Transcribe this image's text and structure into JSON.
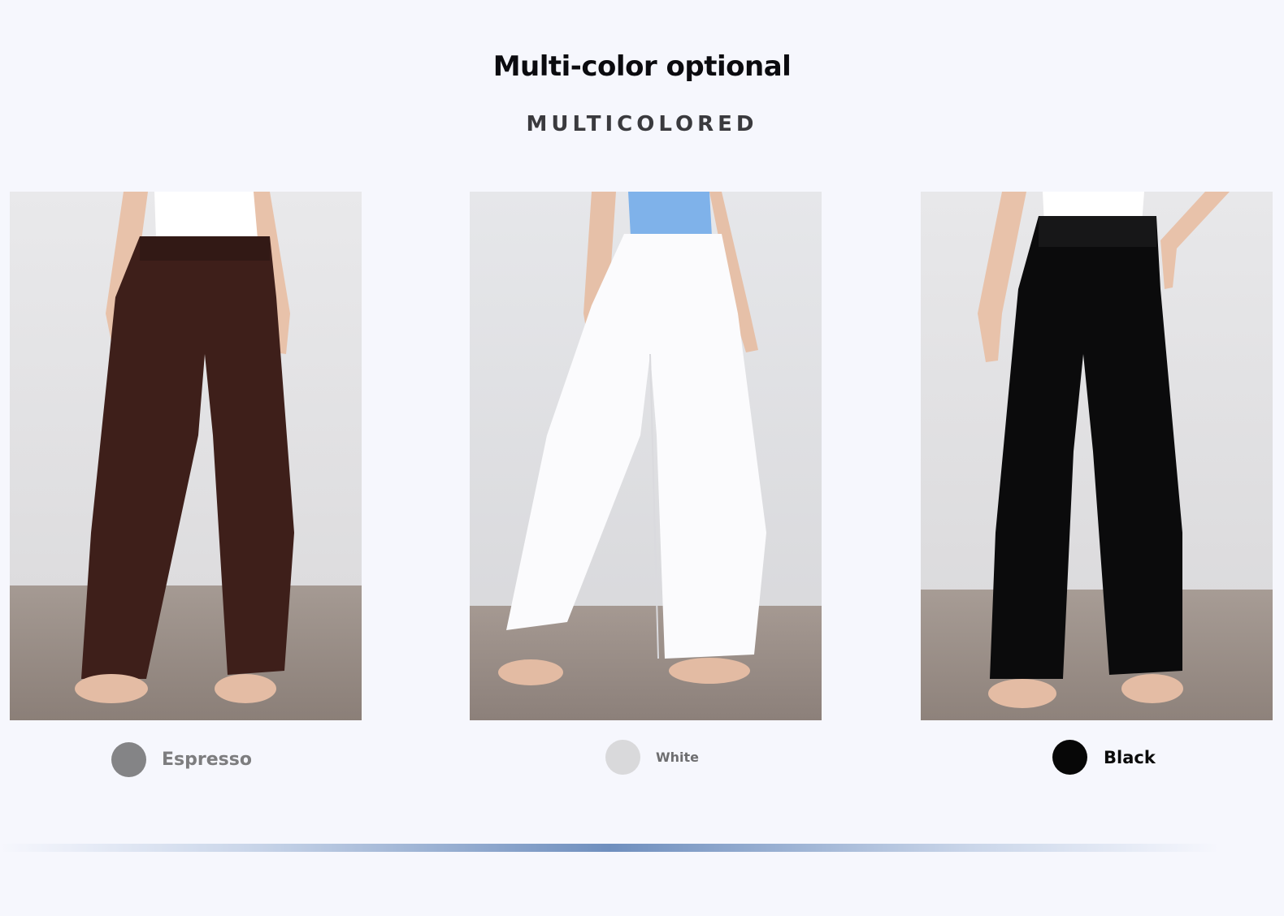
{
  "heading": {
    "title": "Multi-color optional",
    "subtitle": "MULTICOLORED"
  },
  "colors": [
    {
      "name": "Espresso",
      "swatch": "#848486",
      "garment": "#3e1f1a",
      "top": "#ffffff"
    },
    {
      "name": "White",
      "swatch": "#d9d9db",
      "garment": "#fbfbfd",
      "top": "#7fb2ea"
    },
    {
      "name": "Black",
      "swatch": "#070707",
      "garment": "#0b0b0c",
      "top": "#ffffff"
    }
  ],
  "accent": {
    "bar": "#6f8fbe",
    "background": "#f6f7fd"
  }
}
